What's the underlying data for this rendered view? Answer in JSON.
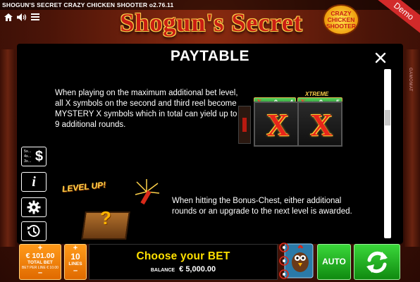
{
  "window": {
    "title": "SHOGUN'S SECRET CRAZY CHICKEN SHOOTER o2.76.11",
    "demo_label": "Demo",
    "logo_text": "Shogun's Secret",
    "badge_lines": [
      "CRAZY",
      "CHICKEN",
      "SHOOTER"
    ],
    "vendor": "GAMOMAT"
  },
  "modal": {
    "title": "PAYTABLE",
    "close_icon": "close-icon",
    "text_1": "When playing on the maximum additional bet level, all X symbols on the second and third reel become MYSTERY X symbols which in total can yield up to 9 additional rounds.",
    "text_2": "When hitting the Bonus-Chest, either additional rounds or an upgrade to the next level is awarded.",
    "reel_tag_1": {
      "x": "X",
      "a": "0",
      "b": "4"
    },
    "reel_tag_2": {
      "prefix": "XTREME",
      "x": "X",
      "a": "0",
      "b": "5"
    },
    "reel_symbol": "X",
    "levelup_text": "LEVEL UP!",
    "chest_symbol": "?"
  },
  "side_tools": {
    "paytable_rows": [
      "5x...",
      "4x...",
      "3x..."
    ],
    "paytable_symbol": "$",
    "info_symbol": "i"
  },
  "bottom": {
    "bet": {
      "plus": "+",
      "amount": "€ 101.00",
      "label": "TOTAL BET",
      "sub": "BET PER LINE € 10.00",
      "minus": "–"
    },
    "lines": {
      "plus": "+",
      "value": "10",
      "label": "LINES",
      "minus": "–"
    },
    "message": "Choose your BET",
    "balance_label": "BALANCE",
    "balance_value": "€ 5,000.00",
    "auto_label": "AUTO"
  },
  "colors": {
    "accent_orange": "#ff9a1a",
    "accent_green": "#3ad83a",
    "message_yellow": "#ffe000",
    "brand_red": "#c81e14"
  }
}
